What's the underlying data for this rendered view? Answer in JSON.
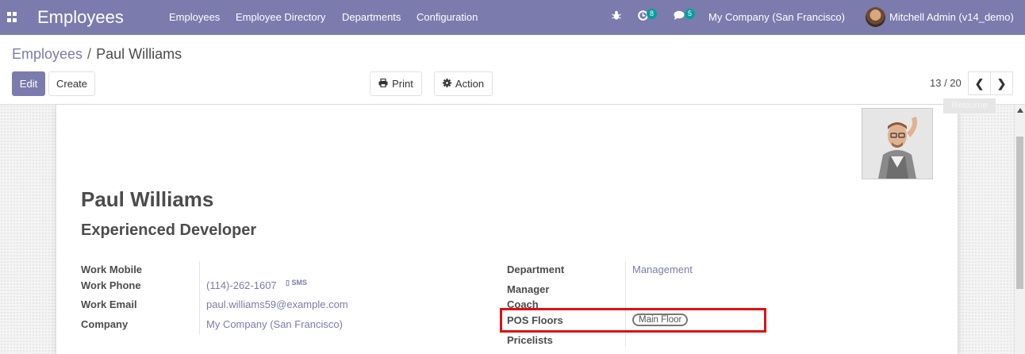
{
  "navbar": {
    "app_title": "Employees",
    "menu": [
      "Employees",
      "Employee Directory",
      "Departments",
      "Configuration"
    ],
    "activity_count": "8",
    "message_count": "5",
    "company": "My Company (San Francisco)",
    "user": "Mitchell Admin (v14_demo)",
    "color": "#7c7bad"
  },
  "breadcrumb": {
    "parent": "Employees",
    "separator": "/",
    "current": "Paul Williams"
  },
  "buttons": {
    "edit": "Edit",
    "create": "Create",
    "print": "Print",
    "action": "Action"
  },
  "pager": {
    "value": "13 / 20"
  },
  "ribbon": "Retourne",
  "employee": {
    "name": "Paul Williams",
    "job_title": "Experienced Developer",
    "left_fields": [
      {
        "label": "Work Mobile",
        "value": ""
      },
      {
        "label": "Work Phone",
        "value": "(114)-262-1607"
      },
      {
        "label": "Work Email",
        "value": "paul.williams59@example.com"
      },
      {
        "label": "Company",
        "value": "My Company (San Francisco)"
      }
    ],
    "sms_label": "SMS",
    "right_fields": [
      {
        "label": "Department",
        "value": "Management"
      },
      {
        "label": "Manager",
        "value": ""
      },
      {
        "label": "Coach",
        "value": ""
      },
      {
        "label": "POS Floors",
        "value": "Main Floor"
      },
      {
        "label": "Pricelists",
        "value": ""
      }
    ]
  }
}
